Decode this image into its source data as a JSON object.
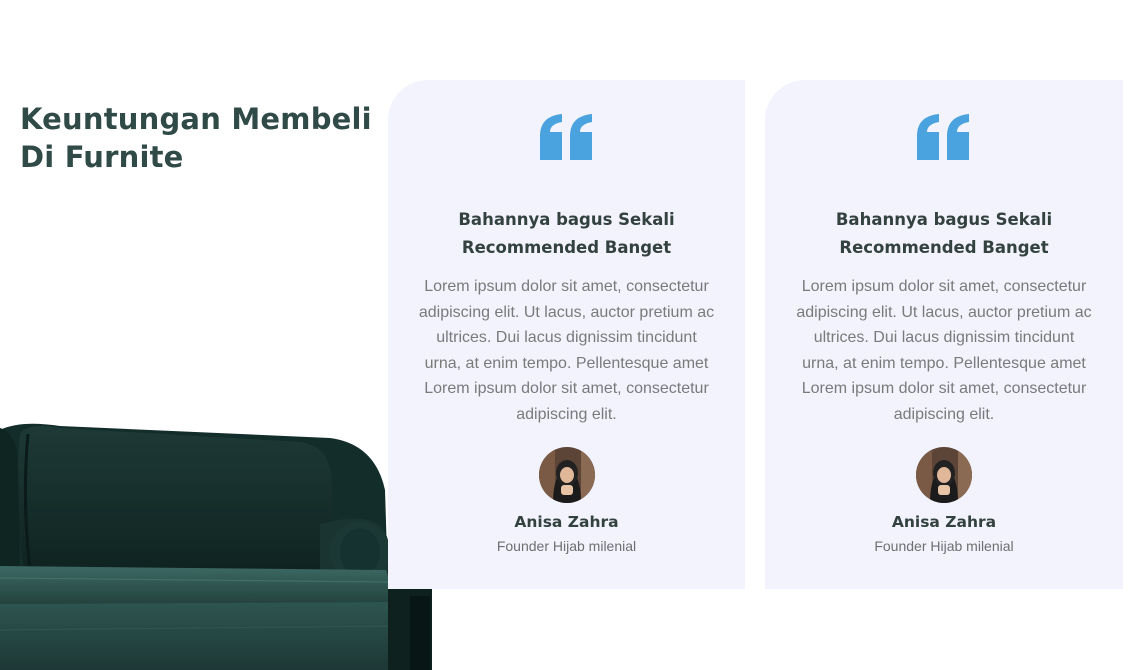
{
  "section": {
    "title": "Keuntungan Membeli Di Furnite"
  },
  "colors": {
    "accent": "#4aa3df",
    "title": "#2f4a47",
    "card_bg": "#f2f3fd",
    "body_text": "#7a7a7a"
  },
  "sofa_image": {
    "icon": "sofa-image"
  },
  "testimonials": [
    {
      "quote_icon": "quote-icon",
      "headline": "Bahannya bagus Sekali Recommended Banget",
      "body": "Lorem ipsum dolor sit amet, consectetur adipiscing elit. Ut lacus, auctor pretium ac ultrices. Dui lacus dignissim tincidunt urna, at enim tempo. Pellentesque amet Lorem ipsum dolor sit amet, consectetur adipiscing elit.",
      "author_name": "Anisa Zahra",
      "author_role": "Founder Hijab milenial"
    },
    {
      "quote_icon": "quote-icon",
      "headline": "Bahannya bagus Sekali Recommended Banget",
      "body": "Lorem ipsum dolor sit amet, consectetur adipiscing elit. Ut lacus, auctor pretium ac ultrices. Dui lacus dignissim tincidunt urna, at enim tempo. Pellentesque amet Lorem ipsum dolor sit amet, consectetur adipiscing elit.",
      "author_name": "Anisa Zahra",
      "author_role": "Founder Hijab milenial"
    }
  ]
}
